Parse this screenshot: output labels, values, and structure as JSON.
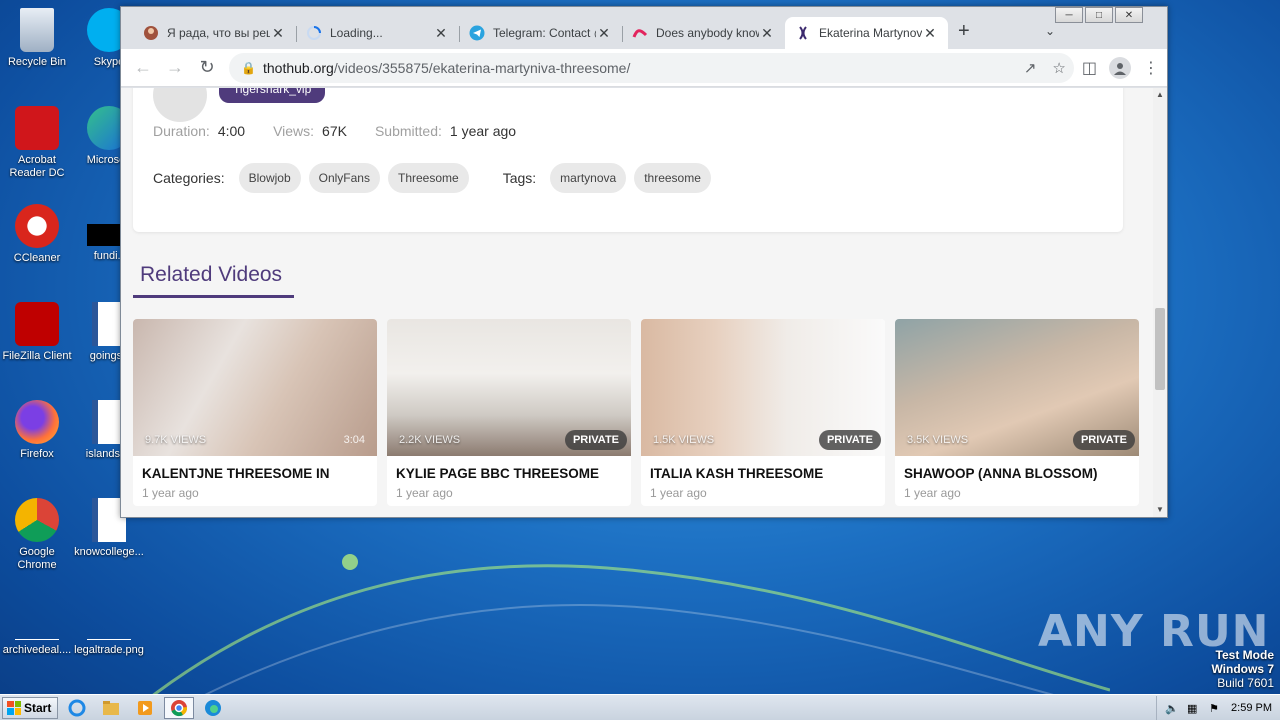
{
  "desktop": {
    "icons": [
      {
        "label": "Recycle Bin"
      },
      {
        "label": "Skype"
      },
      {
        "label": "Acrobat Reader DC"
      },
      {
        "label": "Microsoft"
      },
      {
        "label": "CCleaner"
      },
      {
        "label": "fundi.r"
      },
      {
        "label": "FileZilla Client"
      },
      {
        "label": "goingsh"
      },
      {
        "label": "Firefox"
      },
      {
        "label": "islandsga"
      },
      {
        "label": "Google Chrome"
      },
      {
        "label": "knowcollege..."
      },
      {
        "label": "archivedeal...."
      },
      {
        "label": "legaltrade.png"
      }
    ],
    "watermark": "ANY RUN",
    "test_mode": {
      "line1": "Test Mode",
      "line2": "Windows 7",
      "line3": "Build 7601"
    }
  },
  "taskbar": {
    "start_label": "Start",
    "clock": "2:59 PM"
  },
  "browser": {
    "tabs": [
      {
        "title": "Я рада, что вы реш",
        "favicon": "avatar-icon"
      },
      {
        "title": "Loading...",
        "favicon": "spinner-icon"
      },
      {
        "title": "Telegram: Contact @",
        "favicon": "telegram-icon"
      },
      {
        "title": "Does anybody know",
        "favicon": "reddit-like-icon"
      },
      {
        "title": "Ekaterina Martynova",
        "favicon": "site-icon",
        "active": true
      }
    ],
    "url_host": "thothub.org",
    "url_path": "/videos/355875/ekaterina-martyniva-threesome/"
  },
  "video": {
    "uploader": "Tigershark_vip",
    "duration_label": "Duration:",
    "duration": "4:00",
    "views_label": "Views:",
    "views": "67K",
    "submitted_label": "Submitted:",
    "submitted": "1 year ago",
    "categories_label": "Categories:",
    "categories": [
      "Blowjob",
      "OnlyFans",
      "Threesome"
    ],
    "tags_label": "Tags:",
    "tags": [
      "martynova",
      "threesome"
    ]
  },
  "related": {
    "heading": "Related Videos",
    "items": [
      {
        "title": "KALENTJNE THREESOME IN",
        "views": "9.7K VIEWS",
        "duration": "3:04",
        "private": "",
        "date": "1 year ago"
      },
      {
        "title": "KYLIE PAGE BBC THREESOME",
        "views": "2.2K VIEWS",
        "duration": "",
        "private": "PRIVATE",
        "date": "1 year ago"
      },
      {
        "title": "ITALIA KASH THREESOME",
        "views": "1.5K VIEWS",
        "duration": "",
        "private": "PRIVATE",
        "date": "1 year ago"
      },
      {
        "title": "SHAWOOP (ANNA BLOSSOM)",
        "views": "3.5K VIEWS",
        "duration": "",
        "private": "PRIVATE",
        "date": "1 year ago"
      }
    ]
  },
  "colors": {
    "accent": "#4f3b7c"
  }
}
